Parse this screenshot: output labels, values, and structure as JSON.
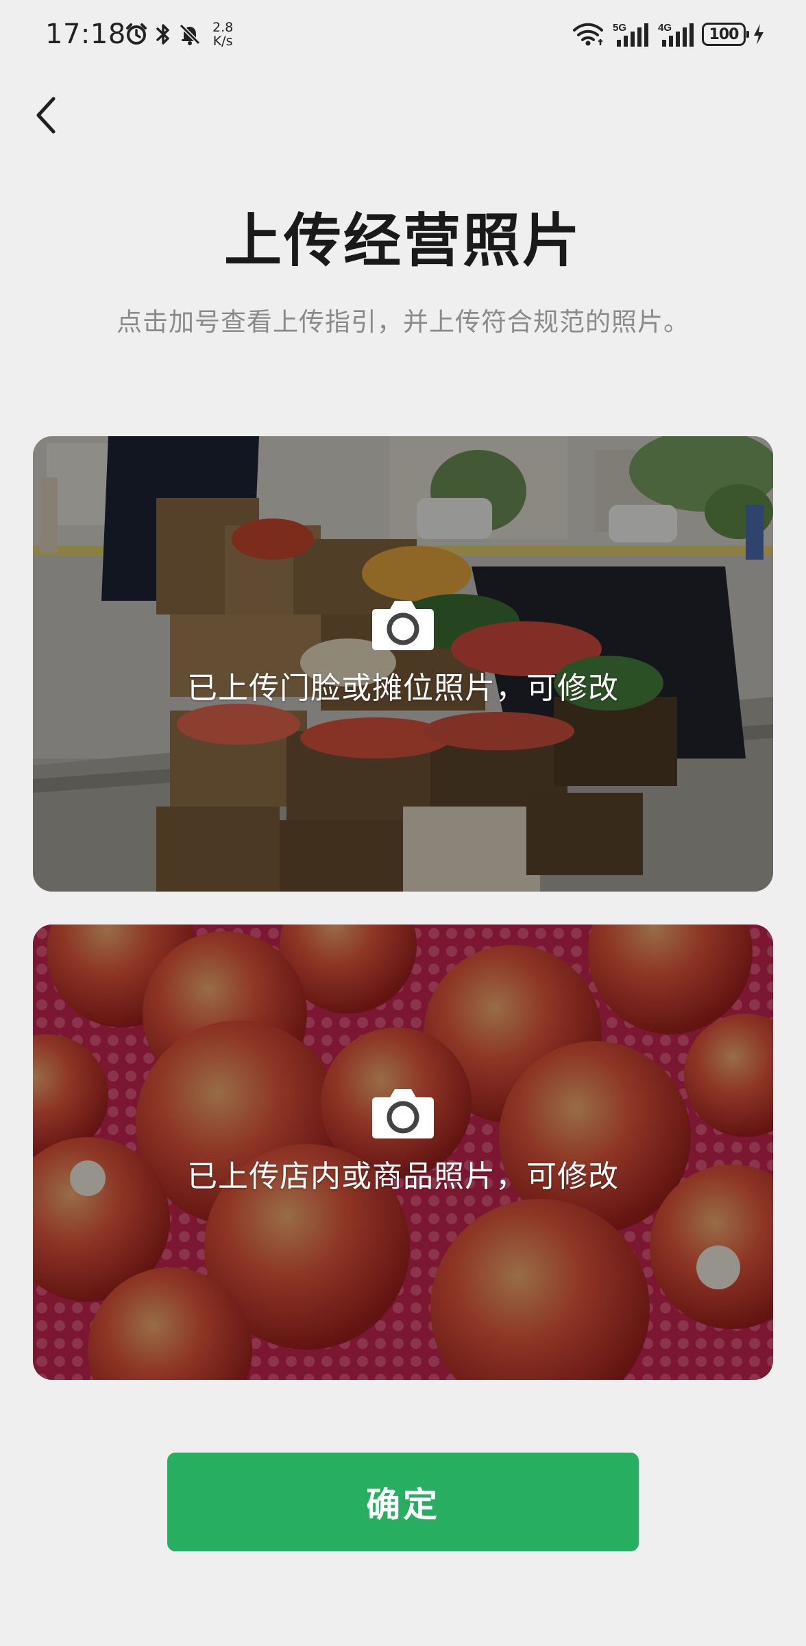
{
  "status_bar": {
    "time": "17:18",
    "net_speed_value": "2.8",
    "net_speed_unit": "K/s",
    "signal_1_label": "5G",
    "signal_2_label": "4G",
    "battery_level": "100"
  },
  "header": {
    "title": "上传经营照片",
    "subtitle": "点击加号查看上传指引，并上传符合规范的照片。"
  },
  "cards": [
    {
      "label": "已上传门脸或摊位照片，可修改",
      "icon": "camera-icon"
    },
    {
      "label": "已上传店内或商品照片，可修改",
      "icon": "camera-icon"
    }
  ],
  "actions": {
    "confirm_label": "确定"
  },
  "colors": {
    "background": "#efefef",
    "accent_green": "#27ae60",
    "subtitle_gray": "#8a8a8a"
  }
}
